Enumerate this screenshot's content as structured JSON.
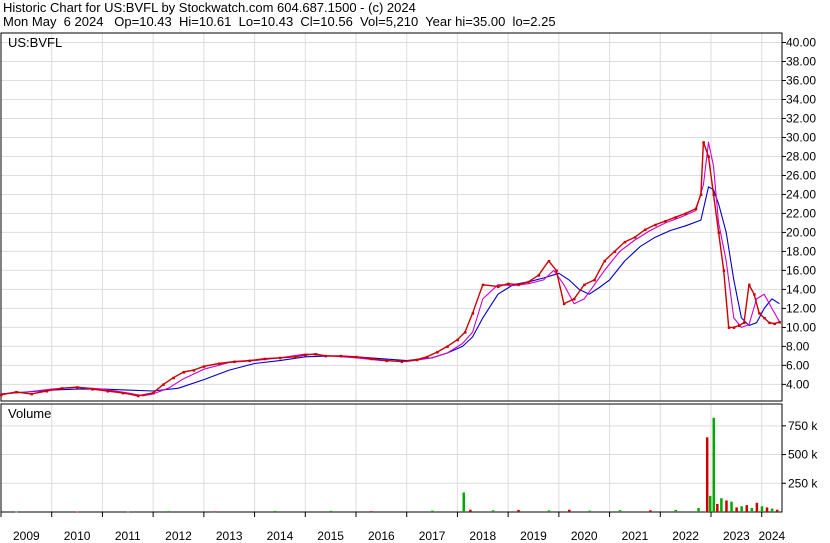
{
  "header": {
    "line1": "Historic Chart for US:BVFL by Stockwatch.com 604.687.1500 - (c) 2024",
    "line2": "Mon May  6 2024   Op=10.43  Hi=10.61  Lo=10.43  Cl=10.56  Vol=5,210  Year hi=35.00  lo=2.25"
  },
  "colors": {
    "price": "#cc0000",
    "close_marker": "#cc0000",
    "ma_short": "#cc00cc",
    "ma_long": "#0000cc",
    "volume_up": "#00aa00",
    "volume_down": "#cc0000",
    "grid": "#dddddd"
  },
  "chart_data": [
    {
      "type": "line",
      "panel_label": "US:BVFL",
      "ylim": [
        2.25,
        41
      ],
      "y_ticks": [
        4,
        6,
        8,
        10,
        12,
        14,
        16,
        18,
        20,
        22,
        24,
        26,
        28,
        30,
        32,
        34,
        36,
        38,
        40
      ],
      "y_tick_labels": [
        "4.00",
        "6.00",
        "8.00",
        "10.00",
        "12.00",
        "14.00",
        "16.00",
        "18.00",
        "20.00",
        "22.00",
        "24.00",
        "26.00",
        "28.00",
        "30.00",
        "32.00",
        "34.00",
        "36.00",
        "38.00",
        "40.00"
      ],
      "x_tick_labels": [
        "2009",
        "2010",
        "2011",
        "2012",
        "2013",
        "2014",
        "2015",
        "2016",
        "2017",
        "2018",
        "2019",
        "2020",
        "2021",
        "2022",
        "2023",
        "2024"
      ],
      "x_range": [
        2009.0,
        2024.4
      ],
      "grid": true,
      "series": [
        {
          "key": "price",
          "x": [
            2009.0,
            2009.3,
            2009.6,
            2009.9,
            2010.2,
            2010.5,
            2010.8,
            2011.1,
            2011.4,
            2011.7,
            2012.0,
            2012.2,
            2012.4,
            2012.6,
            2012.8,
            2013.0,
            2013.3,
            2013.6,
            2013.9,
            2014.2,
            2014.5,
            2014.8,
            2015.0,
            2015.2,
            2015.4,
            2015.7,
            2016.0,
            2016.3,
            2016.6,
            2016.9,
            2017.2,
            2017.4,
            2017.6,
            2017.8,
            2018.0,
            2018.15,
            2018.3,
            2018.5,
            2018.8,
            2019.0,
            2019.2,
            2019.4,
            2019.6,
            2019.8,
            2019.95,
            2020.1,
            2020.3,
            2020.5,
            2020.7,
            2020.9,
            2021.1,
            2021.3,
            2021.5,
            2021.7,
            2021.9,
            2022.1,
            2022.3,
            2022.5,
            2022.7,
            2022.8,
            2022.85,
            2022.95,
            2023.05,
            2023.15,
            2023.25,
            2023.35,
            2023.45,
            2023.55,
            2023.65,
            2023.75,
            2023.85,
            2023.95,
            2024.05,
            2024.15,
            2024.25,
            2024.35
          ],
          "y": [
            2.9,
            3.2,
            3.0,
            3.3,
            3.6,
            3.7,
            3.5,
            3.3,
            3.1,
            2.8,
            3.1,
            4.0,
            4.7,
            5.3,
            5.5,
            5.9,
            6.2,
            6.4,
            6.5,
            6.7,
            6.8,
            6.9,
            7.1,
            7.2,
            7.0,
            7.0,
            6.9,
            6.7,
            6.5,
            6.4,
            6.6,
            6.9,
            7.4,
            8.0,
            8.7,
            9.5,
            11.5,
            14.5,
            14.3,
            14.6,
            14.5,
            14.8,
            15.5,
            17.0,
            16.0,
            12.5,
            13.0,
            14.5,
            15.0,
            17.0,
            18.0,
            19.0,
            19.5,
            20.3,
            20.8,
            21.2,
            21.6,
            22.0,
            22.5,
            24.0,
            29.5,
            28.0,
            24.0,
            20.0,
            16.0,
            10.0,
            10.0,
            10.2,
            10.5,
            14.5,
            13.5,
            11.5,
            11.0,
            10.5,
            10.4,
            10.56
          ]
        },
        {
          "key": "ma_short",
          "x": [
            2009.0,
            2009.5,
            2010.0,
            2010.5,
            2011.0,
            2011.5,
            2011.8,
            2012.0,
            2012.3,
            2012.6,
            2013.0,
            2013.5,
            2014.0,
            2014.5,
            2015.0,
            2015.5,
            2016.0,
            2016.5,
            2017.0,
            2017.5,
            2017.8,
            2018.1,
            2018.3,
            2018.5,
            2018.8,
            2019.1,
            2019.4,
            2019.7,
            2019.9,
            2020.1,
            2020.3,
            2020.5,
            2020.7,
            2020.9,
            2021.2,
            2021.5,
            2021.8,
            2022.1,
            2022.4,
            2022.7,
            2022.85,
            2022.95,
            2023.05,
            2023.15,
            2023.3,
            2023.45,
            2023.6,
            2023.75,
            2023.9,
            2024.05,
            2024.2,
            2024.35
          ],
          "y": [
            3.0,
            3.2,
            3.5,
            3.7,
            3.5,
            3.1,
            2.8,
            3.0,
            3.6,
            4.6,
            5.6,
            6.3,
            6.5,
            6.8,
            7.2,
            7.0,
            6.8,
            6.5,
            6.4,
            6.8,
            7.3,
            8.3,
            9.5,
            13.0,
            14.5,
            14.4,
            14.6,
            15.0,
            16.0,
            14.5,
            12.5,
            13.0,
            14.5,
            16.0,
            18.0,
            19.2,
            20.2,
            21.0,
            21.6,
            22.3,
            25.0,
            29.5,
            27.0,
            21.0,
            17.0,
            11.0,
            10.0,
            10.3,
            13.0,
            13.5,
            12.0,
            10.6
          ]
        },
        {
          "key": "ma_long",
          "x": [
            2009.0,
            2009.5,
            2010.0,
            2010.5,
            2011.0,
            2011.5,
            2012.0,
            2012.5,
            2013.0,
            2013.5,
            2014.0,
            2014.5,
            2015.0,
            2015.5,
            2016.0,
            2016.5,
            2017.0,
            2017.5,
            2017.8,
            2018.1,
            2018.3,
            2018.5,
            2018.8,
            2019.1,
            2019.4,
            2019.7,
            2020.0,
            2020.2,
            2020.4,
            2020.6,
            2020.8,
            2021.0,
            2021.3,
            2021.6,
            2021.9,
            2022.2,
            2022.5,
            2022.8,
            2022.95,
            2023.05,
            2023.15,
            2023.3,
            2023.45,
            2023.6,
            2023.75,
            2023.9,
            2024.05,
            2024.2,
            2024.35
          ],
          "y": [
            3.0,
            3.2,
            3.4,
            3.5,
            3.5,
            3.4,
            3.3,
            3.6,
            4.5,
            5.5,
            6.2,
            6.5,
            6.9,
            7.0,
            6.9,
            6.7,
            6.5,
            6.8,
            7.3,
            8.0,
            9.0,
            11.0,
            13.5,
            14.5,
            14.8,
            15.2,
            15.7,
            15.0,
            14.0,
            13.5,
            14.2,
            15.0,
            17.0,
            18.5,
            19.5,
            20.2,
            20.7,
            21.3,
            24.8,
            24.5,
            23.0,
            20.0,
            15.0,
            11.0,
            10.2,
            10.5,
            12.0,
            13.0,
            12.5
          ]
        }
      ]
    },
    {
      "type": "bar",
      "panel_label": "Volume",
      "ylim": [
        0,
        940000
      ],
      "y_ticks": [
        250000,
        500000,
        750000
      ],
      "y_tick_labels": [
        "250 k",
        "500 k",
        "750 k"
      ],
      "x": [
        2009.3,
        2010.5,
        2011.5,
        2012.3,
        2013.2,
        2014.4,
        2015.5,
        2016.3,
        2017.5,
        2018.12,
        2018.25,
        2018.7,
        2019.2,
        2019.8,
        2020.2,
        2020.6,
        2021.2,
        2021.8,
        2022.3,
        2022.75,
        2022.92,
        2022.98,
        2023.05,
        2023.12,
        2023.2,
        2023.3,
        2023.4,
        2023.5,
        2023.6,
        2023.7,
        2023.8,
        2023.9,
        2024.0,
        2024.1,
        2024.2,
        2024.3
      ],
      "values": [
        5000,
        4000,
        3000,
        8000,
        6000,
        9000,
        10000,
        7000,
        12000,
        170000,
        20000,
        15000,
        18000,
        14000,
        20000,
        12000,
        16000,
        15000,
        18000,
        35000,
        650000,
        140000,
        820000,
        70000,
        120000,
        100000,
        90000,
        40000,
        50000,
        60000,
        35000,
        80000,
        50000,
        40000,
        30000,
        20000
      ],
      "direction": [
        "up",
        "down",
        "up",
        "up",
        "down",
        "up",
        "up",
        "down",
        "up",
        "up",
        "down",
        "up",
        "down",
        "up",
        "down",
        "up",
        "up",
        "down",
        "up",
        "up",
        "down",
        "up",
        "up",
        "down",
        "up",
        "down",
        "up",
        "down",
        "up",
        "down",
        "up",
        "down",
        "up",
        "down",
        "up",
        "down"
      ]
    }
  ]
}
